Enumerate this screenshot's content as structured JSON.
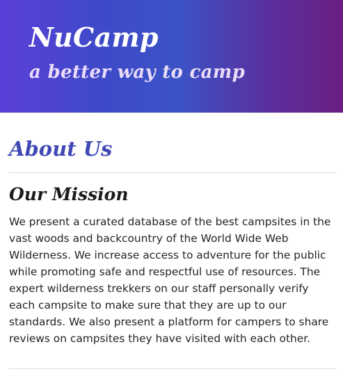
{
  "header": {
    "brand": "NuCamp",
    "tagline": "a better way to camp"
  },
  "main": {
    "title": "About Us",
    "mission": {
      "heading": "Our Mission",
      "body": "We present a curated database of the best campsites in the vast woods and backcountry of the World Wide Web Wilderness. We increase access to adventure for the public while promoting safe and respectful use of resources. The expert wilderness trekkers on our staff personally verify each campsite to make sure that they are up to our standards. We also present a platform for campers to share reviews on campsites they have visited with each other."
    }
  },
  "colors": {
    "header_gradient_start": "#5b3fd8",
    "header_gradient_mid": "#3b53c6",
    "header_gradient_end": "#6a1f83",
    "about_title": "#3f48b4",
    "mission_heading": "#1c1c1c",
    "body_text": "#212529",
    "divider": "#dcdcdc"
  }
}
